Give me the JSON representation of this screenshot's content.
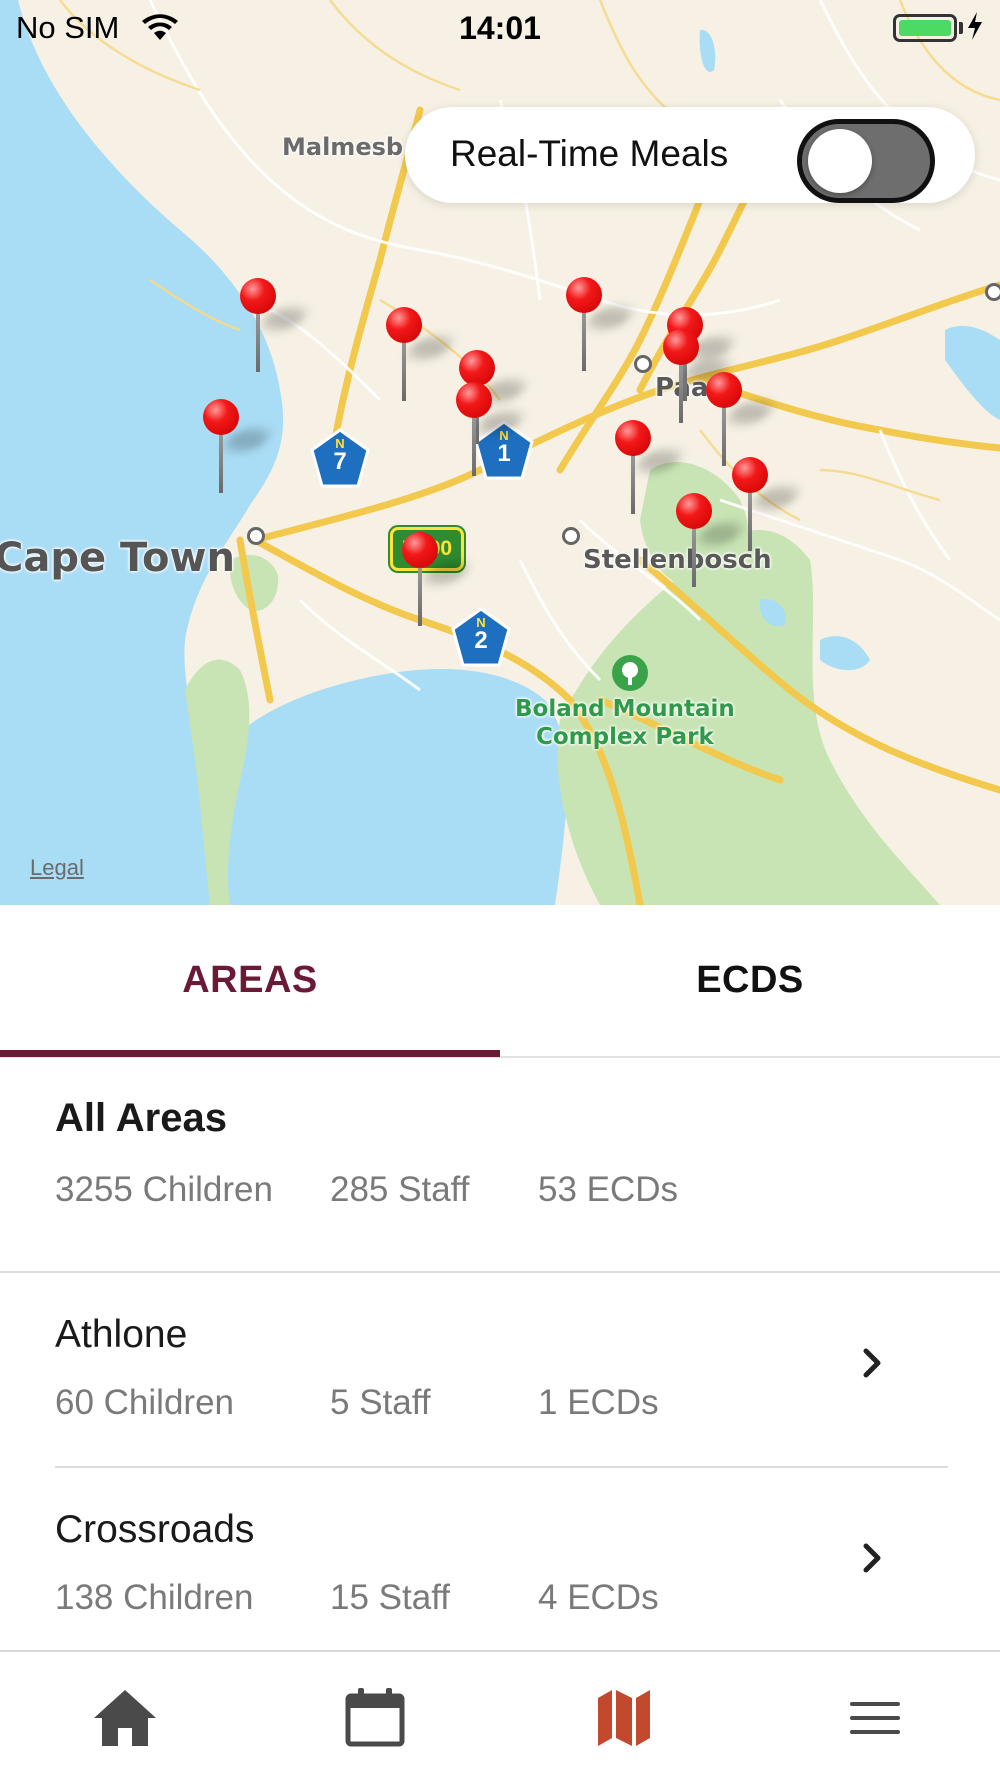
{
  "status_bar": {
    "carrier": "No SIM",
    "time": "14:01"
  },
  "map": {
    "places": {
      "cape_town": "Cape Town",
      "malmesbury": "Malmesb",
      "paarl": "Paarl",
      "stellenbosch": "Stellenbosch",
      "park_line1": "Boland Mountain",
      "park_line2": "Complex Park"
    },
    "shields": {
      "n7": {
        "prefix": "N",
        "number": "7"
      },
      "n1": {
        "prefix": "N",
        "number": "1"
      },
      "n2": {
        "prefix": "N",
        "number": "2"
      },
      "r300": "R300"
    },
    "legal": "Legal",
    "pin_count": 13
  },
  "toggle": {
    "label": "Real-Time Meals",
    "state": "off"
  },
  "tabs": {
    "areas": "AREAS",
    "ecds": "ECDS",
    "active": "AREAS"
  },
  "summary": {
    "title": "All Areas",
    "children": "3255 Children",
    "staff": "285 Staff",
    "ecds": "53 ECDs"
  },
  "areas": [
    {
      "name": "Athlone",
      "children": "60 Children",
      "staff": "5 Staff",
      "ecds": "1 ECDs"
    },
    {
      "name": "Crossroads",
      "children": "138 Children",
      "staff": "15 Staff",
      "ecds": "4 ECDs"
    }
  ],
  "bottom_nav": {
    "items": [
      "home-icon",
      "calendar-icon",
      "map-icon",
      "menu-icon"
    ],
    "active": "map-icon"
  },
  "colors": {
    "brand": "#6a1a35",
    "nav_active": "#c2492d",
    "nav_inactive": "#4a4a4a",
    "pin": "#e40000",
    "water": "#a9dcf5",
    "park": "#c8e4b4"
  }
}
